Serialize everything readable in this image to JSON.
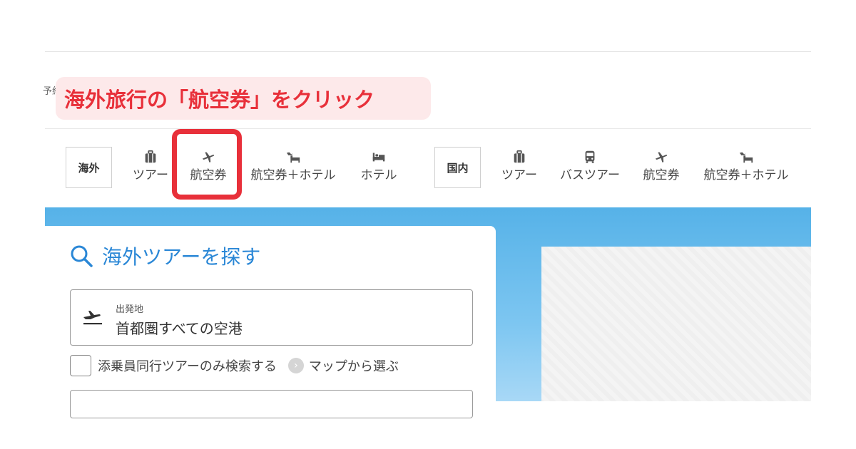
{
  "callout": {
    "text": "海外旅行の「航空券」をクリック"
  },
  "cut_text": "予約",
  "nav": {
    "overseas": {
      "label": "海外",
      "items": [
        {
          "label": "ツアー",
          "icon": "suitcase-icon"
        },
        {
          "label": "航空券",
          "icon": "airplane-icon"
        },
        {
          "label": "航空券＋ホテル",
          "icon": "flight-hotel-icon"
        },
        {
          "label": "ホテル",
          "icon": "bed-icon"
        }
      ]
    },
    "domestic": {
      "label": "国内",
      "items": [
        {
          "label": "ツアー",
          "icon": "suitcase-icon"
        },
        {
          "label": "バスツアー",
          "icon": "bus-icon"
        },
        {
          "label": "航空券",
          "icon": "airplane-icon"
        },
        {
          "label": "航空券＋ホテル",
          "icon": "flight-hotel-icon"
        }
      ]
    }
  },
  "search": {
    "title": "海外ツアーを探す",
    "departure_label": "出発地",
    "departure_value": "首都圏すべての空港",
    "checkbox_label": "添乗員同行ツアーのみ検索する",
    "map_link": "マップから選ぶ",
    "map_link_icon": "chevron-right-icon"
  },
  "colors": {
    "accent_red": "#e8303a",
    "callout_bg": "#fde9ea",
    "link_blue": "#2a87d6",
    "hero_blue": "#56b2e8"
  }
}
